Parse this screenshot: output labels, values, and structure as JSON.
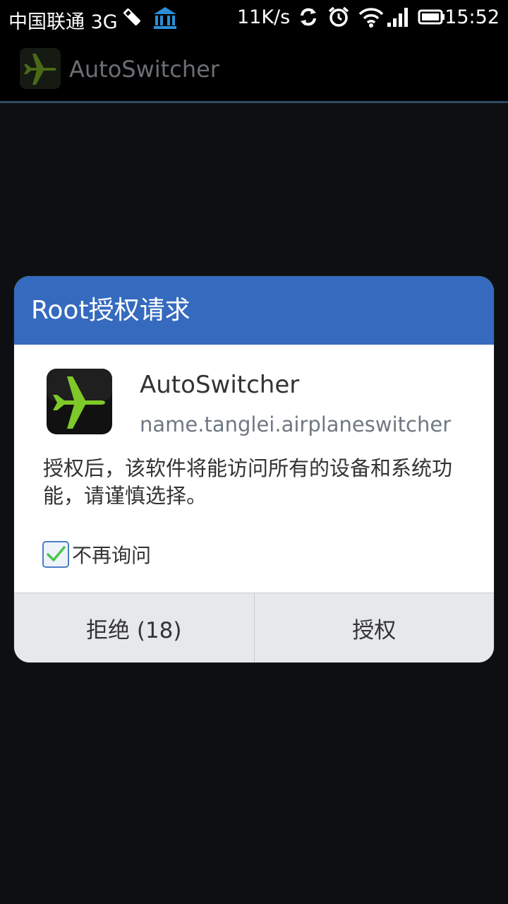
{
  "status_bar": {
    "carrier": "中国联通 3G",
    "net_speed": "11K/s",
    "time": "15:52",
    "icons": [
      "usb-debug-icon",
      "bank-icon",
      "sync-icon",
      "alarm-icon",
      "wifi-icon",
      "signal-icon",
      "battery-icon"
    ]
  },
  "action_bar": {
    "title": "AutoSwitcher",
    "icon": "airplane-icon"
  },
  "dialog": {
    "title": "Root授权请求",
    "app_name": "AutoSwitcher",
    "package_name": "name.tanglei.airplaneswitcher",
    "message": "授权后，该软件将能访问所有的设备和系统功能，请谨慎选择。",
    "checkbox": {
      "label": "不再询问",
      "checked": true
    },
    "buttons": {
      "deny": "拒绝 (18)",
      "grant": "授权"
    },
    "accent_color": "#356abf"
  }
}
